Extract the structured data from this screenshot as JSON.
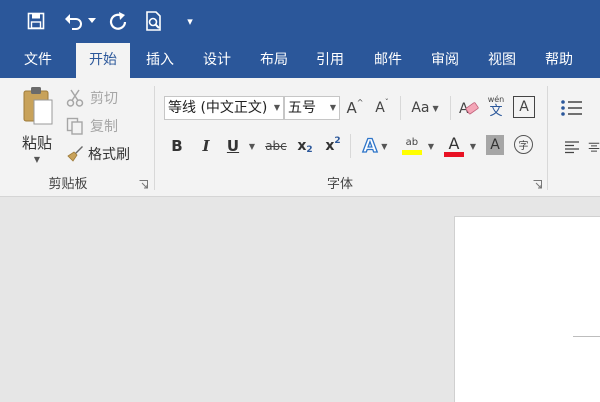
{
  "qat": {
    "customize_glyph": "▾"
  },
  "tabs": [
    {
      "label": "文件"
    },
    {
      "label": "开始"
    },
    {
      "label": "插入"
    },
    {
      "label": "设计"
    },
    {
      "label": "布局"
    },
    {
      "label": "引用"
    },
    {
      "label": "邮件"
    },
    {
      "label": "审阅"
    },
    {
      "label": "视图"
    },
    {
      "label": "帮助"
    }
  ],
  "clipboard": {
    "paste_label": "粘贴",
    "cut_label": "剪切",
    "copy_label": "复制",
    "format_painter_label": "格式刷",
    "group_label": "剪贴板"
  },
  "font": {
    "font_name": "等线 (中文正文)",
    "font_size": "五号",
    "grow_glyph": "A",
    "shrink_glyph": "A",
    "change_case_glyph": "Aa",
    "phonetic_top": "wén",
    "phonetic_bottom": "文",
    "border_glyph": "A",
    "bold_glyph": "B",
    "italic_glyph": "I",
    "underline_glyph": "U",
    "strike_glyph": "abc",
    "sub_glyph": "x",
    "sub_mark": "2",
    "sup_glyph": "x",
    "sup_mark": "2",
    "effects_glyph": "A",
    "highlight_glyph": "ab",
    "color_glyph": "A",
    "shading_glyph": "A",
    "enclose_glyph": "字",
    "group_label": "字体"
  },
  "colors": {
    "ribbon_blue": "#2b579a",
    "highlight_yellow": "#ffff00",
    "font_red": "#e81123"
  }
}
